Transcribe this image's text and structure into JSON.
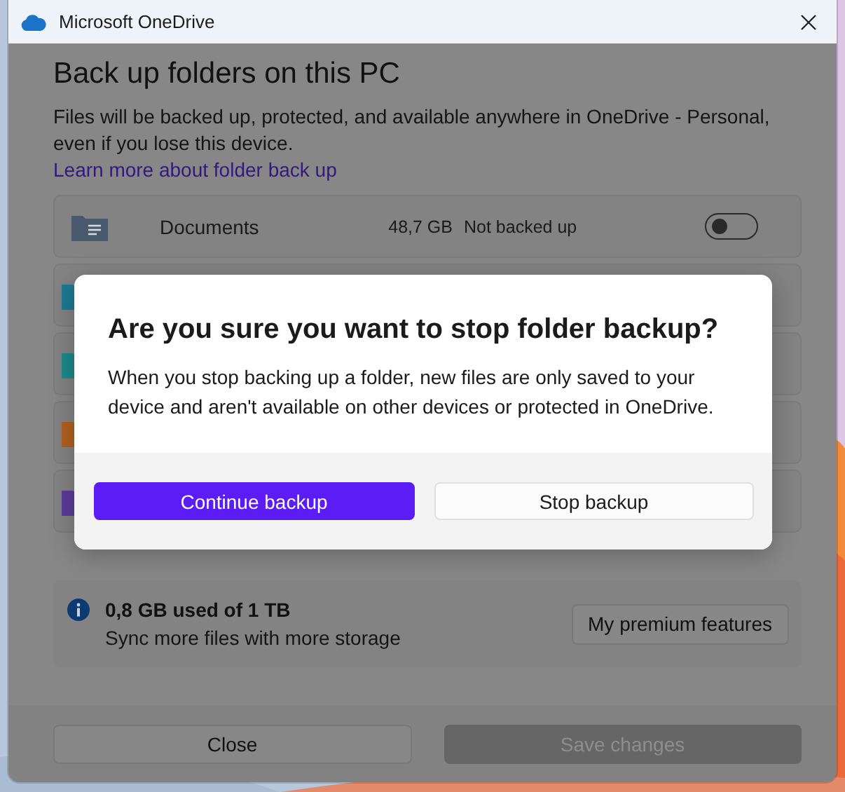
{
  "window": {
    "title": "Microsoft OneDrive"
  },
  "page": {
    "heading": "Back up folders on this PC",
    "description": "Files will be backed up, protected, and available anywhere in OneDrive - Personal, even if you lose this device.",
    "link": "Learn more about folder back up"
  },
  "folders": [
    {
      "name": "Documents",
      "size": "48,7 GB",
      "status": "Not backed up",
      "on": false,
      "color": "#4a5a6e"
    },
    {
      "color": "#1d7a93"
    },
    {
      "color": "#1d8a8a"
    },
    {
      "color": "#b0601e"
    },
    {
      "color": "#5a3c9a"
    }
  ],
  "storage": {
    "usage": "0,8 GB used of 1 TB",
    "hint": "Sync more files with more storage",
    "button": "My premium features"
  },
  "footer": [
    {
      "label": "Close",
      "disabled": false
    },
    {
      "label": "Save changes",
      "disabled": true
    }
  ],
  "dialog": {
    "title": "Are you sure you want to stop folder backup?",
    "body": "When you stop backing up a folder, new files are only saved to your device and aren't available on other devices or protected in OneDrive.",
    "buttons": [
      {
        "label": "Continue backup",
        "kind": "primary"
      },
      {
        "label": "Stop backup",
        "kind": "secondary"
      }
    ]
  }
}
